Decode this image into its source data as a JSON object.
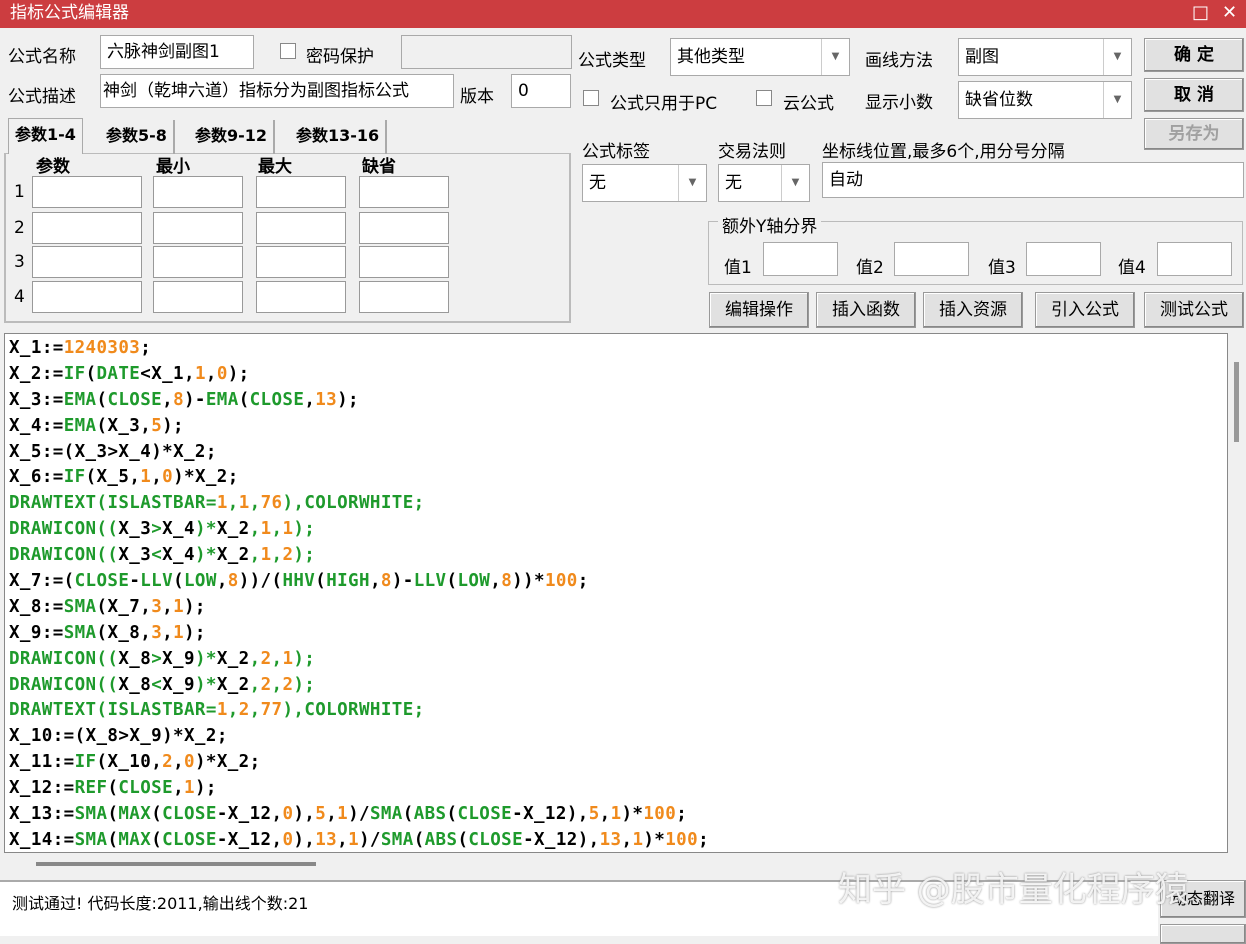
{
  "window": {
    "title": "指标公式编辑器",
    "max_icon": "□",
    "close_icon": "✕"
  },
  "form": {
    "name_label": "公式名称",
    "name_value": "六脉神剑副图1",
    "password_label": "密码保护",
    "desc_label": "公式描述",
    "desc_value": "神剑（乾坤六道）指标分为副图指标公式",
    "version_label": "版本",
    "version_value": "0",
    "type_label": "公式类型",
    "type_value": "其他类型",
    "draw_label": "画线方法",
    "draw_value": "副图",
    "pc_only_label": "公式只用于PC",
    "cloud_label": "云公式",
    "decimals_label": "显示小数",
    "decimals_value": "缺省位数",
    "tag_label": "公式标签",
    "tag_value": "无",
    "rule_label": "交易法则",
    "rule_value": "无",
    "axis_label": "坐标线位置,最多6个,用分号分隔",
    "axis_value": "自动",
    "yaxis_group": "额外Y轴分界",
    "yvals": [
      "值1",
      "值2",
      "值3",
      "值4"
    ]
  },
  "buttons": {
    "ok": "确 定",
    "cancel": "取 消",
    "save_as": "另存为",
    "edit": "编辑操作",
    "insert_fn": "插入函数",
    "insert_res": "插入资源",
    "import": "引入公式",
    "test": "测试公式",
    "translate": "动态翻译"
  },
  "tabs": [
    "参数1-4",
    "参数5-8",
    "参数9-12",
    "参数13-16"
  ],
  "param_headers": [
    "参数",
    "最小",
    "最大",
    "缺省"
  ],
  "param_rows": [
    "1",
    "2",
    "3",
    "4"
  ],
  "code": [
    "X_1:=1240303;",
    "X_2:=IF(DATE<X_1,1,0);",
    "X_3:=EMA(CLOSE,8)-EMA(CLOSE,13);",
    "X_4:=EMA(X_3,5);",
    "X_5:=(X_3>X_4)*X_2;",
    "X_6:=IF(X_5,1,0)*X_2;",
    "DRAWTEXT(ISLASTBAR=1,1,76),COLORWHITE;",
    "DRAWICON((X_3>X_4)*X_2,1,1);",
    "DRAWICON((X_3<X_4)*X_2,1,2);",
    "X_7:=(CLOSE-LLV(LOW,8))/(HHV(HIGH,8)-LLV(LOW,8))*100;",
    "X_8:=SMA(X_7,3,1);",
    "X_9:=SMA(X_8,3,1);",
    "DRAWICON((X_8>X_9)*X_2,2,1);",
    "DRAWICON((X_8<X_9)*X_2,2,2);",
    "DRAWTEXT(ISLASTBAR=1,2,77),COLORWHITE;",
    "X_10:=(X_8>X_9)*X_2;",
    "X_11:=IF(X_10,2,0)*X_2;",
    "X_12:=REF(CLOSE,1);",
    "X_13:=SMA(MAX(CLOSE-X_12,0),5,1)/SMA(ABS(CLOSE-X_12),5,1)*100;",
    "X_14:=SMA(MAX(CLOSE-X_12,0),13,1)/SMA(ABS(CLOSE-X_12),13,1)*100;"
  ],
  "status": "测试通过! 代码长度:2011,输出线个数:21",
  "watermark": "知乎 @股市量化程序猿",
  "colors": {
    "title": "#cc3d40",
    "function": "#1e9a2c",
    "number": "#f08a1c"
  }
}
